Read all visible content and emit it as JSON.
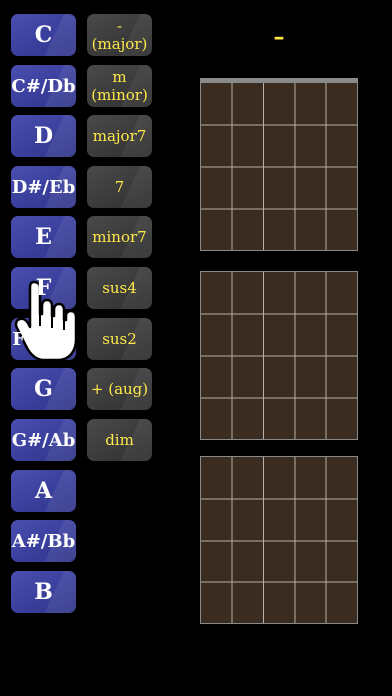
{
  "notes": [
    "C",
    "C#/Db",
    "D",
    "D#/Eb",
    "E",
    "F",
    "F#/Gb",
    "G",
    "G#/Ab",
    "A",
    "A#/Bb",
    "B"
  ],
  "qualities": [
    "- (major)",
    "m\n(minor)",
    "major7",
    "7",
    "minor7",
    "sus4",
    "sus2",
    "+ (aug)",
    "dim"
  ],
  "chord_display": "–",
  "icons": {
    "pointer": "hand-pointer-icon"
  },
  "colors": {
    "note_button": "#3e43a4",
    "quality_button": "#3c3c3c",
    "quality_text": "#ffe94a",
    "fretboard": "#3a2c20"
  }
}
